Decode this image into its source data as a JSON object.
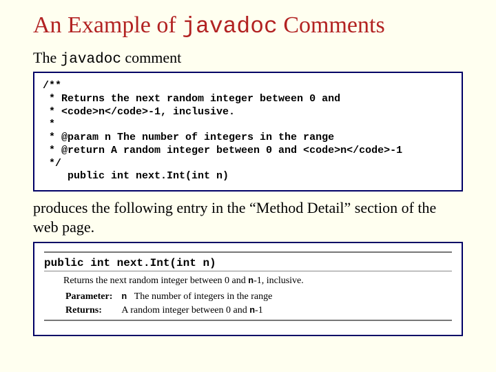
{
  "title": {
    "pre": "An Example of ",
    "mono": "javadoc",
    "post": " Comments"
  },
  "intro": {
    "pre": "The ",
    "mono": "javadoc",
    "post": " comment"
  },
  "code": {
    "l1": "/**",
    "l2": " * Returns the next random integer between 0 and",
    "l3": " * <code>n</code>-1, inclusive.",
    "l4": " *",
    "l5": " * @param n The number of integers in the range",
    "l6": " * @return A random integer between 0 and <code>n</code>-1",
    "l7": " */",
    "l8": "    public int next.Int(int n)"
  },
  "midtext": "produces the following entry in the “Method Detail” section of the web page.",
  "output": {
    "signature": "public int next.Int(int n)",
    "description_pre": "Returns the next random integer between 0 and ",
    "description_n": "n",
    "description_post": "-1, inclusive.",
    "param_label": "Parameter:",
    "param_name": "n",
    "param_desc": "The number of integers in the range",
    "return_label": "Returns:",
    "return_desc_pre": "A random integer between 0 and ",
    "return_desc_n": "n",
    "return_desc_post": "-1"
  }
}
